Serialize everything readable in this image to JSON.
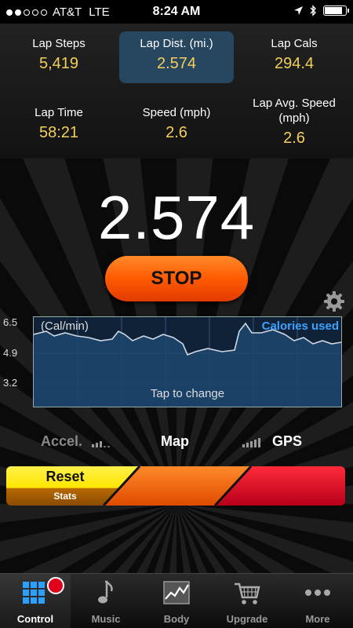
{
  "status": {
    "carrier": "AT&T",
    "network": "LTE",
    "time": "8:24 AM",
    "signal_filled": 2,
    "signal_total": 5
  },
  "stats": [
    {
      "label": "Lap Steps",
      "value": "5,419",
      "selected": false
    },
    {
      "label": "Lap Dist. (mi.)",
      "value": "2.574",
      "selected": true
    },
    {
      "label": "Lap Cals",
      "value": "294.4",
      "selected": false
    },
    {
      "label": "Lap Time",
      "value": "58:21",
      "selected": false
    },
    {
      "label": "Speed (mph)",
      "value": "2.6",
      "selected": false
    },
    {
      "label": "Lap Avg. Speed (mph)",
      "value": "2.6",
      "selected": false
    }
  ],
  "main": {
    "big_value": "2.574",
    "stop_label": "STOP"
  },
  "graph": {
    "unit_label": "(Cal/min)",
    "series_label": "Calories used",
    "hint": "Tap to change",
    "yticks": [
      "6.5",
      "4.9",
      "3.2"
    ]
  },
  "modes": {
    "accel": "Accel.",
    "map": "Map",
    "gps": "GPS"
  },
  "slider": {
    "reset_label": "Reset",
    "stats_label": "Stats"
  },
  "tabs": [
    {
      "label": "Control",
      "icon": "grid-icon",
      "active": true
    },
    {
      "label": "Music",
      "icon": "music-note-icon",
      "active": false
    },
    {
      "label": "Body",
      "icon": "chart-icon",
      "active": false
    },
    {
      "label": "Upgrade",
      "icon": "cart-icon",
      "active": false
    },
    {
      "label": "More",
      "icon": "more-dots-icon",
      "active": false
    }
  ],
  "colors": {
    "value_yellow": "#f4d05a",
    "stop_orange": "#ff5a00",
    "graph_blue": "#3aa3ff",
    "reset_yellow": "#ffe600",
    "slider_red": "#d8001c",
    "badge_red": "#e0001a"
  }
}
